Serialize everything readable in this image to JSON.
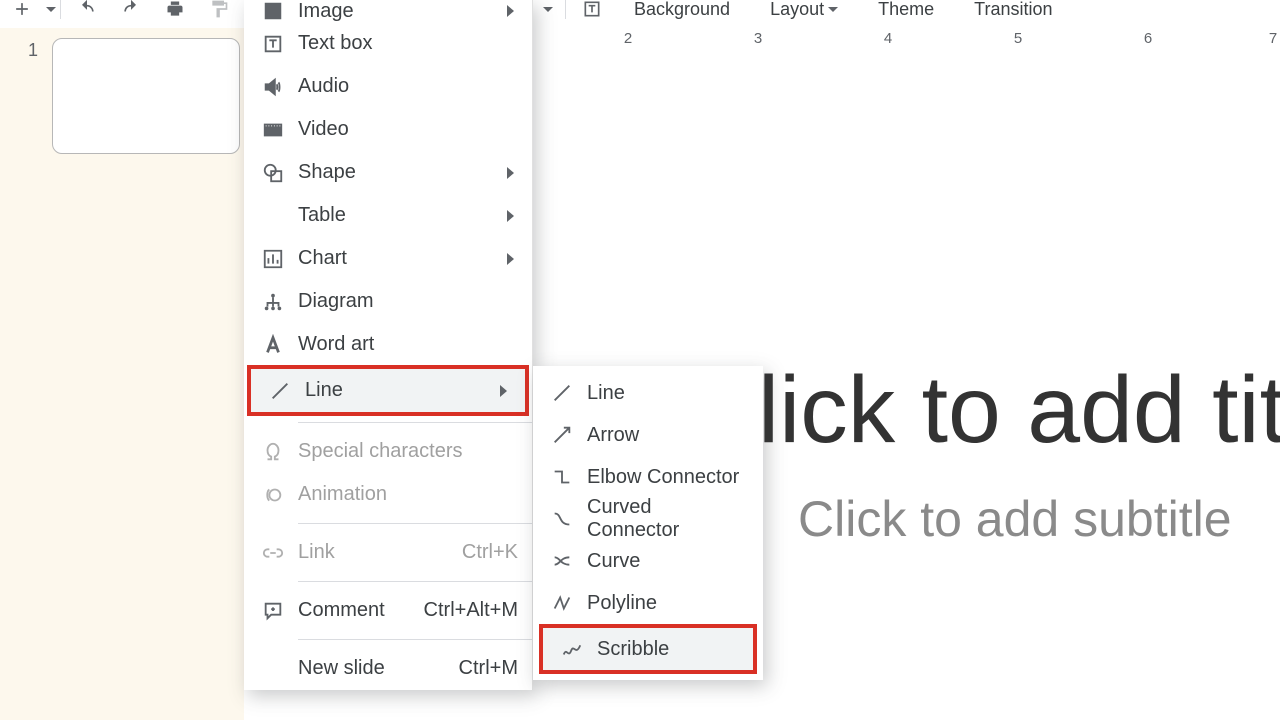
{
  "toolbar": {
    "background": "Background",
    "layout": "Layout",
    "theme": "Theme",
    "transition": "Transition"
  },
  "thumb": {
    "index": "1"
  },
  "ruler": {
    "t2": "2",
    "t3": "3",
    "t4": "4",
    "t5": "5",
    "t6": "6",
    "t7": "7"
  },
  "canvas": {
    "title_placeholder": "lick to add tit",
    "subtitle_placeholder": "Click to add subtitle"
  },
  "menu": {
    "image": "Image",
    "textbox": "Text box",
    "audio": "Audio",
    "video": "Video",
    "shape": "Shape",
    "table": "Table",
    "chart": "Chart",
    "diagram": "Diagram",
    "wordart": "Word art",
    "line": "Line",
    "special": "Special characters",
    "animation": "Animation",
    "link": "Link",
    "link_sc": "Ctrl+K",
    "comment": "Comment",
    "comment_sc": "Ctrl+Alt+M",
    "newslide": "New slide",
    "newslide_sc": "Ctrl+M"
  },
  "submenu": {
    "line": "Line",
    "arrow": "Arrow",
    "elbow": "Elbow Connector",
    "curved": "Curved Connector",
    "curve": "Curve",
    "polyline": "Polyline",
    "scribble": "Scribble"
  }
}
